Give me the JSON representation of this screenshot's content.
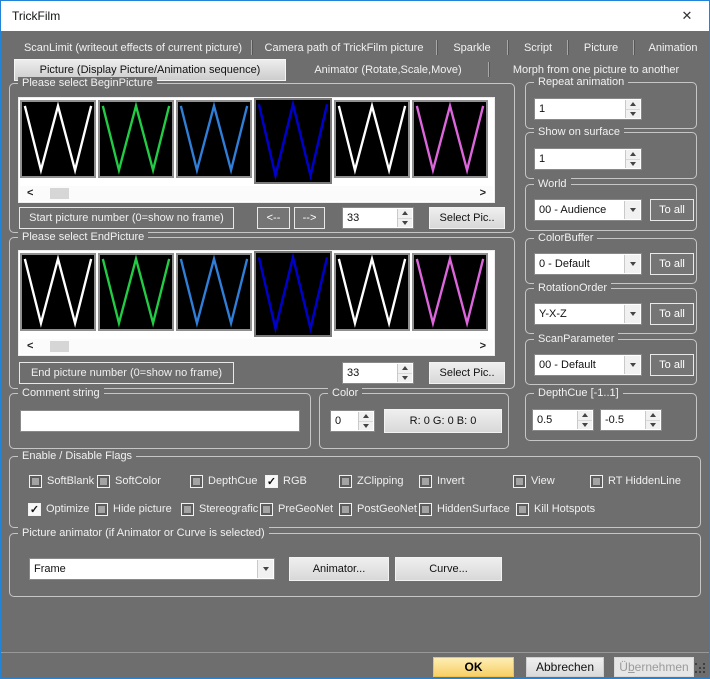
{
  "window": {
    "title": "TrickFilm"
  },
  "icons": {
    "close": "✕",
    "scroll_left": "<",
    "scroll_right": ">"
  },
  "tabs": {
    "row1": [
      {
        "label": "ScanLimit (writeout effects of current picture)"
      },
      {
        "label": "Camera path of TrickFilm picture"
      },
      {
        "label": "Sparkle"
      },
      {
        "label": "Script"
      },
      {
        "label": "Picture"
      },
      {
        "label": "Animation"
      }
    ],
    "row2": [
      {
        "label": "Picture (Display Picture/Animation sequence)",
        "selected": true
      },
      {
        "label": "Animator (Rotate,Scale,Move)",
        "selected": false
      },
      {
        "label": "Morph from one picture to another",
        "selected": false
      }
    ]
  },
  "begin_picture": {
    "group_label": "Please select BeginPicture",
    "number_label": "Start picture number (0=show no frame)",
    "prev": "<--",
    "next": "-->",
    "value": "33",
    "select_button": "Select Pic.."
  },
  "end_picture": {
    "group_label": "Please select EndPicture",
    "number_label": "End picture number (0=show no frame)",
    "value": "33",
    "select_button": "Select Pic.."
  },
  "thumbnails": {
    "wave_colors": [
      "#ffffff",
      "#22cc44",
      "#2f7fd9",
      "#0000cc",
      "#ffffff",
      "#dd66dd"
    ],
    "selected_index": 3
  },
  "comment": {
    "group_label": "Comment string",
    "value": ""
  },
  "color": {
    "group_label": "Color",
    "value": "0",
    "rgb_button": "R: 0 G: 0 B: 0"
  },
  "right_panel": {
    "repeat_animation": {
      "label": "Repeat animation",
      "value": "1"
    },
    "show_on_surface": {
      "label": "Show on surface",
      "value": "1"
    },
    "world": {
      "label": "World",
      "value": "00 - Audience",
      "button": "To all"
    },
    "color_buffer": {
      "label": "ColorBuffer",
      "value": "0 - Default",
      "button": "To all"
    },
    "rotation_order": {
      "label": "RotationOrder",
      "value": "Y-X-Z",
      "button": "To all"
    },
    "scan_parameter": {
      "label": "ScanParameter",
      "value": "00 - Default",
      "button": "To all"
    },
    "depth_cue": {
      "label": "DepthCue [-1..1]",
      "value_a": "0.5",
      "value_b": "-0.5"
    }
  },
  "flags": {
    "group_label": "Enable / Disable Flags",
    "row1": [
      {
        "label": "SoftBlank",
        "checked": false
      },
      {
        "label": "SoftColor",
        "checked": false
      },
      {
        "label": "DepthCue",
        "checked": false
      },
      {
        "label": "RGB",
        "checked": true
      },
      {
        "label": "ZClipping",
        "checked": false
      },
      {
        "label": "Invert",
        "checked": false
      },
      {
        "label": "View",
        "checked": false
      },
      {
        "label": "RT HiddenLine",
        "checked": false
      }
    ],
    "row2": [
      {
        "label": "Optimize",
        "checked": true
      },
      {
        "label": "Hide picture",
        "checked": false
      },
      {
        "label": "Stereografic",
        "checked": false
      },
      {
        "label": "PreGeoNet",
        "checked": false
      },
      {
        "label": "PostGeoNet",
        "checked": false
      },
      {
        "label": "HiddenSurface",
        "checked": false
      },
      {
        "label": "Kill Hotspots",
        "checked": false
      }
    ]
  },
  "picture_animator": {
    "group_label": "Picture animator (if Animator or Curve is selected)",
    "value": "Frame",
    "animator_button": "Animator...",
    "curve_button": "Curve..."
  },
  "footer": {
    "ok": "OK",
    "cancel": "Abbrechen",
    "apply_pre": "Ü",
    "apply_mnemonic": "b",
    "apply_post": "ernehmen"
  },
  "colors": {
    "window_border": "#2383d6",
    "body": "#6e6e6e",
    "ok_accent": "#f7cf66"
  }
}
